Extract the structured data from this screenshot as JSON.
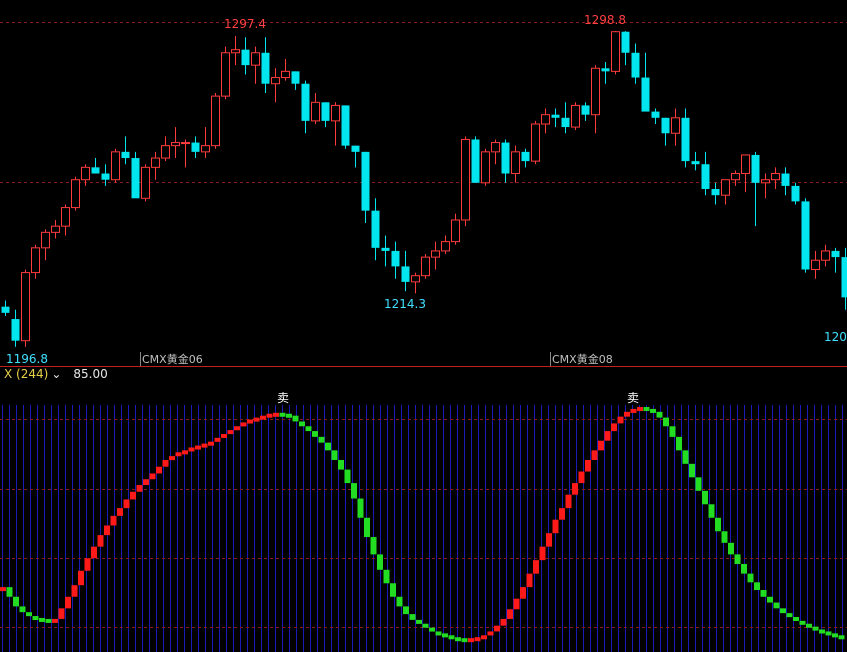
{
  "colors": {
    "background": "#000000",
    "up_candle": "#ff3b3b",
    "down_candle": "#00e5ee",
    "grid_dash": "#8a1a1a",
    "separator": "#c02020",
    "indicator_up": "#ff1a1a",
    "indicator_down": "#22dd22",
    "indicator_bg_line": "#1a1ab8",
    "label_red": "#ff4040",
    "label_cyan": "#40e0ff",
    "contract_label": "#c0c0c0"
  },
  "price_panel": {
    "labels": {
      "high_1": "1297.4",
      "high_2": "1298.8",
      "low_mid": "1214.3",
      "low_left": "1196.8",
      "low_right": "120",
      "contract_1": "CMX黄金06",
      "contract_2": "CMX黄金08"
    }
  },
  "indicator": {
    "name": "X (244)",
    "value": "85.00",
    "signal_label": "卖"
  },
  "chart_data": [
    {
      "type": "candlestick",
      "title": "",
      "ylim": [
        1196.8,
        1298.8
      ],
      "annotations": [
        "1297.4",
        "1298.8",
        "1214.3",
        "1196.8",
        "120",
        "CMX黄金06",
        "CMX黄金08"
      ],
      "candles": [
        [
          1210,
          1212,
          1207,
          1208
        ],
        [
          1206,
          1209,
          1197,
          1199
        ],
        [
          1199,
          1222,
          1197,
          1221
        ],
        [
          1221,
          1230,
          1219,
          1229
        ],
        [
          1229,
          1235,
          1225,
          1234
        ],
        [
          1234,
          1238,
          1232,
          1236
        ],
        [
          1236,
          1243,
          1233,
          1242
        ],
        [
          1242,
          1252,
          1241,
          1251
        ],
        [
          1251,
          1256,
          1249,
          1255
        ],
        [
          1255,
          1258,
          1253,
          1253
        ],
        [
          1253,
          1256,
          1249,
          1251
        ],
        [
          1251,
          1261,
          1250,
          1260
        ],
        [
          1260,
          1265,
          1256,
          1258
        ],
        [
          1258,
          1260,
          1250,
          1245
        ],
        [
          1245,
          1256,
          1244,
          1255
        ],
        [
          1255,
          1260,
          1251,
          1258
        ],
        [
          1258,
          1265,
          1257,
          1262
        ],
        [
          1262,
          1268,
          1258,
          1263
        ],
        [
          1263,
          1264,
          1255,
          1263
        ],
        [
          1263,
          1265,
          1258,
          1260
        ],
        [
          1260,
          1268,
          1258,
          1262
        ],
        [
          1262,
          1279,
          1261,
          1278
        ],
        [
          1278,
          1294,
          1277,
          1292
        ],
        [
          1292,
          1297.4,
          1288,
          1293
        ],
        [
          1293,
          1297,
          1285,
          1288
        ],
        [
          1288,
          1294,
          1282,
          1292
        ],
        [
          1292,
          1297,
          1279,
          1282
        ],
        [
          1282,
          1287,
          1276,
          1284
        ],
        [
          1284,
          1290,
          1283,
          1286
        ],
        [
          1286,
          1286,
          1280,
          1282
        ],
        [
          1282,
          1283,
          1266,
          1270
        ],
        [
          1270,
          1279,
          1269,
          1276
        ],
        [
          1276,
          1276,
          1268,
          1270
        ],
        [
          1270,
          1276,
          1262,
          1275
        ],
        [
          1275,
          1275,
          1261,
          1262
        ],
        [
          1262,
          1262,
          1255,
          1260
        ],
        [
          1260,
          1260,
          1237,
          1241
        ],
        [
          1241,
          1245,
          1225,
          1229
        ],
        [
          1229,
          1233,
          1223,
          1228
        ],
        [
          1228,
          1231,
          1219,
          1223
        ],
        [
          1223,
          1228,
          1215,
          1218
        ],
        [
          1218,
          1221,
          1214.3,
          1220
        ],
        [
          1220,
          1227,
          1219,
          1226
        ],
        [
          1226,
          1231,
          1222,
          1228
        ],
        [
          1228,
          1233,
          1227,
          1231
        ],
        [
          1231,
          1240,
          1230,
          1238
        ],
        [
          1238,
          1265,
          1236,
          1264
        ],
        [
          1264,
          1265,
          1250,
          1250
        ],
        [
          1250,
          1261,
          1249,
          1260
        ],
        [
          1260,
          1264,
          1256,
          1263
        ],
        [
          1263,
          1264,
          1250,
          1253
        ],
        [
          1253,
          1262,
          1250,
          1260
        ],
        [
          1260,
          1261,
          1255,
          1257
        ],
        [
          1257,
          1270,
          1256,
          1269
        ],
        [
          1269,
          1274,
          1266,
          1272
        ],
        [
          1272,
          1274,
          1268,
          1271
        ],
        [
          1271,
          1276,
          1266,
          1268
        ],
        [
          1268,
          1276,
          1267,
          1275
        ],
        [
          1275,
          1276,
          1270,
          1272
        ],
        [
          1272,
          1288,
          1266,
          1287
        ],
        [
          1287,
          1289,
          1282,
          1286
        ],
        [
          1286,
          1299,
          1285,
          1298.8
        ],
        [
          1298.8,
          1299,
          1288,
          1292
        ],
        [
          1292,
          1295,
          1282,
          1284
        ],
        [
          1284,
          1292,
          1279,
          1273
        ],
        [
          1273,
          1274,
          1269,
          1271
        ],
        [
          1271,
          1271,
          1262,
          1266
        ],
        [
          1266,
          1274,
          1262,
          1271
        ],
        [
          1271,
          1274,
          1255,
          1257
        ],
        [
          1257,
          1260,
          1254,
          1256
        ],
        [
          1256,
          1260,
          1246,
          1248
        ],
        [
          1248,
          1250,
          1243,
          1246
        ],
        [
          1246,
          1251,
          1243,
          1251
        ],
        [
          1251,
          1254,
          1249,
          1253
        ],
        [
          1253,
          1259,
          1247,
          1259
        ],
        [
          1259,
          1260,
          1236,
          1250
        ],
        [
          1250,
          1253,
          1245,
          1251
        ],
        [
          1251,
          1255,
          1248,
          1253
        ],
        [
          1253,
          1255,
          1246,
          1249
        ],
        [
          1249,
          1250,
          1243,
          1244
        ],
        [
          1244,
          1245,
          1221,
          1222
        ],
        [
          1222,
          1228,
          1219,
          1225
        ],
        [
          1225,
          1230,
          1223,
          1228
        ],
        [
          1228,
          1229,
          1221,
          1226
        ],
        [
          1226,
          1229,
          1209,
          1213
        ],
        [
          1213,
          1214,
          1205,
          1209
        ]
      ]
    },
    {
      "type": "bar",
      "title": "",
      "series": [
        {
          "values": [
            58,
            48,
            38,
            32,
            28,
            26,
            25,
            24,
            25,
            36,
            48,
            60,
            75,
            88,
            100,
            112,
            122,
            132,
            140,
            149,
            157,
            164,
            170,
            176,
            183,
            190,
            194,
            198,
            200,
            203,
            205,
            207,
            209,
            213,
            217,
            221,
            225,
            229,
            232,
            234,
            236,
            238,
            239,
            238,
            236,
            230,
            225,
            220,
            214,
            208,
            200,
            190,
            180,
            166,
            150,
            130,
            110,
            92,
            76,
            62,
            48,
            38,
            30,
            24,
            20,
            16,
            12,
            10,
            8,
            6,
            5,
            4,
            5,
            6,
            8,
            12,
            18,
            25,
            35,
            46,
            58,
            72,
            86,
            100,
            114,
            128,
            140,
            154,
            166,
            178,
            190,
            200,
            210,
            220,
            228,
            235,
            240,
            243,
            245,
            243,
            240,
            234,
            225,
            214,
            200,
            186,
            172,
            158,
            144,
            130,
            116,
            104,
            92,
            82,
            72,
            63,
            55,
            48,
            42,
            36,
            31,
            27,
            23,
            20,
            17,
            14,
            12,
            10,
            8,
            7
          ]
        }
      ]
    }
  ]
}
